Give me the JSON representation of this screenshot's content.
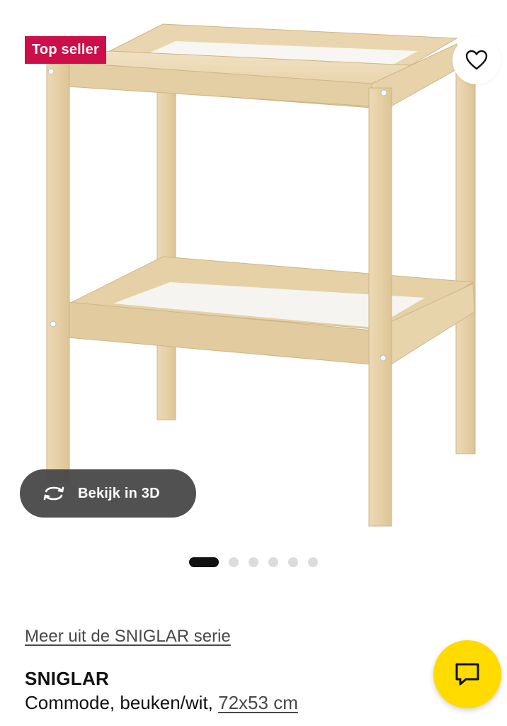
{
  "product": {
    "badge": "Top seller",
    "view3d_label": "Bekijk in 3D",
    "series_link": "Meer uit de SNIGLAR serie",
    "name": "SNIGLAR",
    "description": "Commode, beuken/wit, ",
    "size": "72x53 cm"
  },
  "gallery": {
    "total_images": 6,
    "active_index": 0
  },
  "icons": {
    "favorite": "heart-icon",
    "view3d": "rotate-3d-icon",
    "chat": "chat-bubble-icon"
  },
  "colors": {
    "badge_bg": "#cc0f4b",
    "chat_bg": "#ffdb00",
    "wood": "#e8d4ad",
    "wood_dark": "#d8c095"
  }
}
